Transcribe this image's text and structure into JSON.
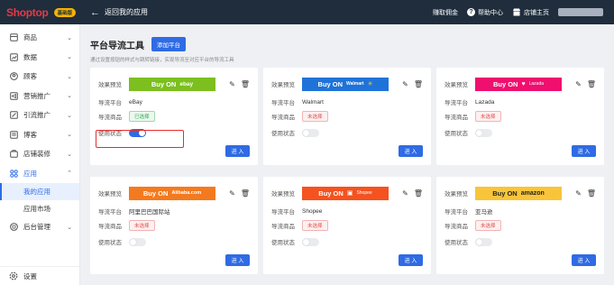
{
  "topbar": {
    "logo": "Shoptop",
    "badge": "基础版",
    "back_label": "返回我的应用",
    "earn_label": "赚取佣金",
    "help_label": "帮助中心",
    "store_label": "店铺主页"
  },
  "sidebar": {
    "items": [
      {
        "label": "商品",
        "icon": "box-icon"
      },
      {
        "label": "数据",
        "icon": "chart-icon"
      },
      {
        "label": "顾客",
        "icon": "user-icon"
      },
      {
        "label": "营销推广",
        "icon": "megaphone-icon"
      },
      {
        "label": "引流推广",
        "icon": "link-icon"
      },
      {
        "label": "博客",
        "icon": "blog-icon"
      },
      {
        "label": "店铺装修",
        "icon": "palette-icon"
      },
      {
        "label": "应用",
        "icon": "apps-icon"
      }
    ],
    "sub_items": [
      "我的应用",
      "应用市场"
    ],
    "extra_item": {
      "label": "后台管理",
      "icon": "admin-icon"
    },
    "settings_label": "设置"
  },
  "main": {
    "title": "平台导流工具",
    "add_button": "添加平台",
    "description": "通过设置按钮的样式与跳转链接，实现导流至对应平台的导流工具"
  },
  "labels": {
    "effect": "效果预览",
    "platform": "导流平台",
    "products": "导流商品",
    "status": "使用状态",
    "enter": "进 入"
  },
  "colors": {
    "primary": "#2f6be4",
    "topbar": "#1f2d3d"
  },
  "cards": [
    {
      "platform": "eBay",
      "banner": "Buy ON",
      "brand": "ebay",
      "color": "#7cbf1f",
      "tag": "已选择",
      "tag_type": "green",
      "enabled": true
    },
    {
      "platform": "Walmart",
      "banner": "Buy ON",
      "brand": "Walmart",
      "color": "#1f73d8",
      "tag": "未选择",
      "tag_type": "red",
      "enabled": false
    },
    {
      "platform": "Lazada",
      "banner": "Buy ON",
      "brand": "Lazada",
      "color": "#ef0f6e",
      "tag": "未选择",
      "tag_type": "red",
      "enabled": false
    },
    {
      "platform": "阿里巴巴国际站",
      "banner": "Buy ON",
      "brand": "Alibaba.com",
      "color": "#f47a1f",
      "tag": "未选择",
      "tag_type": "red",
      "enabled": false
    },
    {
      "platform": "Shopee",
      "banner": "Buy ON",
      "brand": "Shopee",
      "color": "#f5521f",
      "tag": "未选择",
      "tag_type": "red",
      "enabled": false
    },
    {
      "platform": "亚马逊",
      "banner": "Buy ON",
      "brand": "amazon",
      "color": "#f8c53a",
      "tag": "未选择",
      "tag_type": "red",
      "enabled": false
    }
  ]
}
